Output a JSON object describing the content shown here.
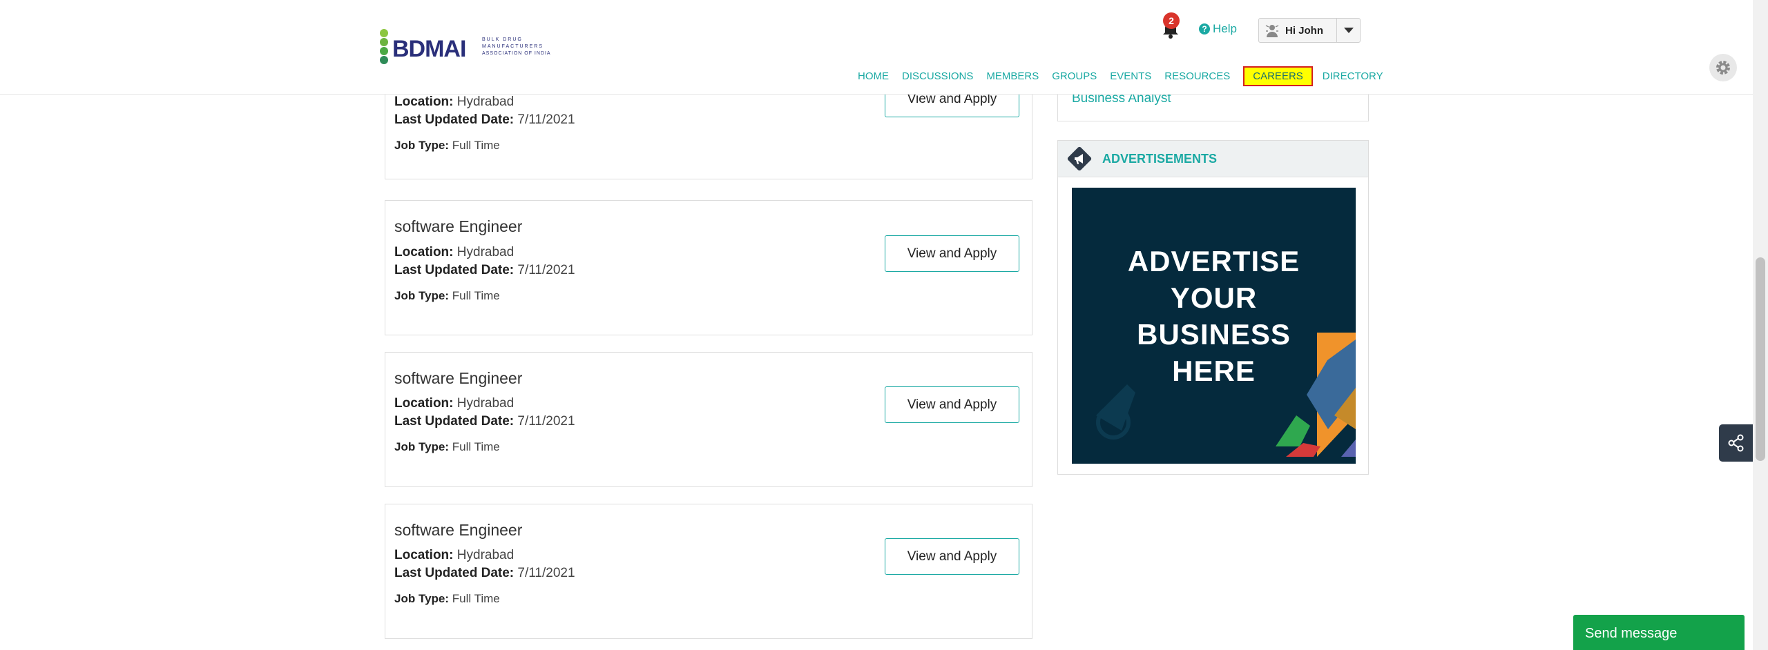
{
  "header": {
    "logo": {
      "mark": "BDMAI",
      "tagline_lines": [
        "BULK DRUG",
        "MANUFACTURERS",
        "ASSOCIATION OF INDIA"
      ]
    },
    "notifications_count": "2",
    "help_label": "Help",
    "user_label": "Hi John"
  },
  "nav": {
    "items": [
      "HOME",
      "DISCUSSIONS",
      "MEMBERS",
      "GROUPS",
      "EVENTS",
      "RESOURCES",
      "CAREERS",
      "DIRECTORY"
    ],
    "active": "CAREERS"
  },
  "labels": {
    "location": "Location:",
    "last_updated": "Last Updated Date:",
    "job_type": "Job Type:",
    "apply_button": "View and Apply"
  },
  "jobs": [
    {
      "title": "",
      "location": "Hydrabad",
      "last_updated": "7/11/2021",
      "job_type": "Full Time"
    },
    {
      "title": "software Engineer",
      "location": "Hydrabad",
      "last_updated": "7/11/2021",
      "job_type": "Full Time"
    },
    {
      "title": "software Engineer",
      "location": "Hydrabad",
      "last_updated": "7/11/2021",
      "job_type": "Full Time"
    },
    {
      "title": "software Engineer",
      "location": "Hydrabad",
      "last_updated": "7/11/2021",
      "job_type": "Full Time"
    }
  ],
  "sidebar": {
    "top_link": "Business Analyst",
    "ads_title": "ADVERTISEMENTS",
    "ad_banner_lines": [
      "ADVERTISE",
      "YOUR",
      "BUSINESS",
      "HERE"
    ]
  },
  "send_message_label": "Send message",
  "colors": {
    "accent": "#1aa9a3",
    "active_nav_bg": "#ffff00",
    "active_nav_border": "#d42020",
    "send_button": "#13a24a",
    "ad_bg": "#052a3d"
  }
}
